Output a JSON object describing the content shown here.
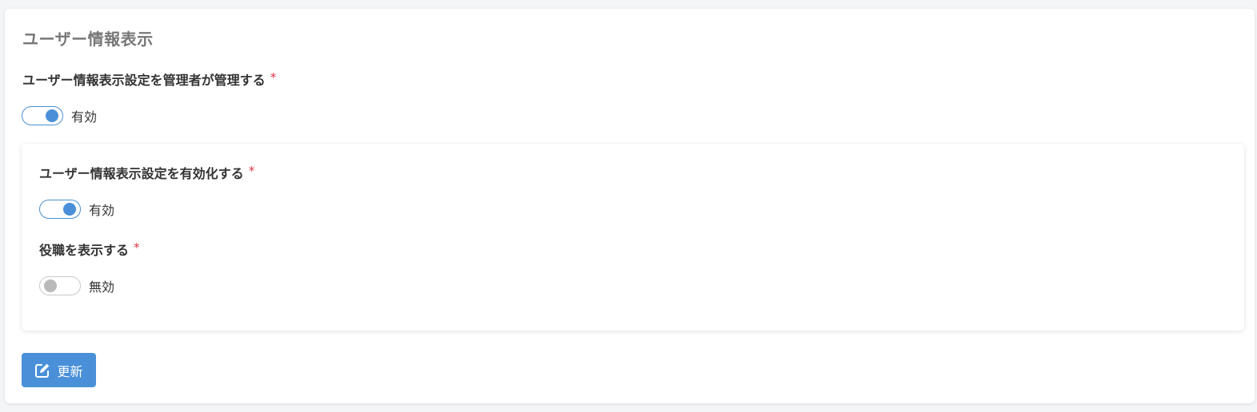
{
  "section": {
    "title": "ユーザー情報表示"
  },
  "admin_manage": {
    "label": "ユーザー情報表示設定を管理者が管理する",
    "required_mark": "*",
    "state": "on",
    "state_text": "有効"
  },
  "enable_display": {
    "label": "ユーザー情報表示設定を有効化する",
    "required_mark": "*",
    "state": "on",
    "state_text": "有効"
  },
  "show_position": {
    "label": "役職を表示する",
    "required_mark": "*",
    "state": "off",
    "state_text": "無効"
  },
  "update_button": {
    "label": "更新",
    "icon": "edit-icon"
  },
  "colors": {
    "accent": "#4a90d9",
    "required": "#dc3545",
    "toggle_off": "#b9b9b9"
  }
}
